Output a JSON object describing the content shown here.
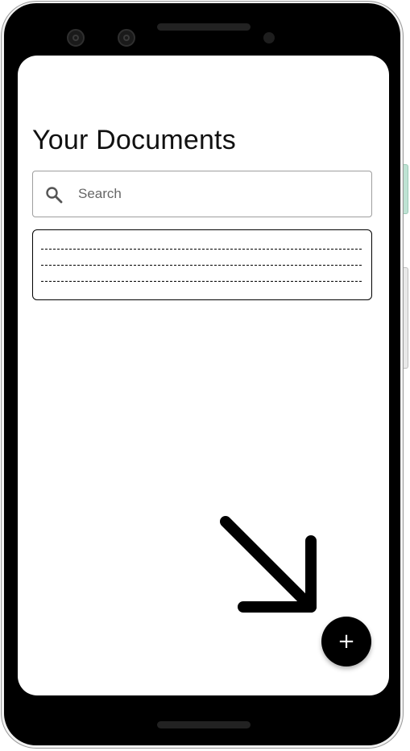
{
  "screen": {
    "title": "Your Documents"
  },
  "search": {
    "placeholder": "Search",
    "value": "",
    "icon": "search-icon"
  },
  "document_list": {
    "items": [
      {
        "lines": 3,
        "line_style": "dashed-placeholder"
      }
    ]
  },
  "annotation": {
    "icon": "arrow-down-right-icon"
  },
  "fab": {
    "label": "+",
    "icon": "add-icon"
  },
  "colors": {
    "accent": "#000000",
    "background": "#ffffff",
    "search_border": "#9e9e9e"
  }
}
